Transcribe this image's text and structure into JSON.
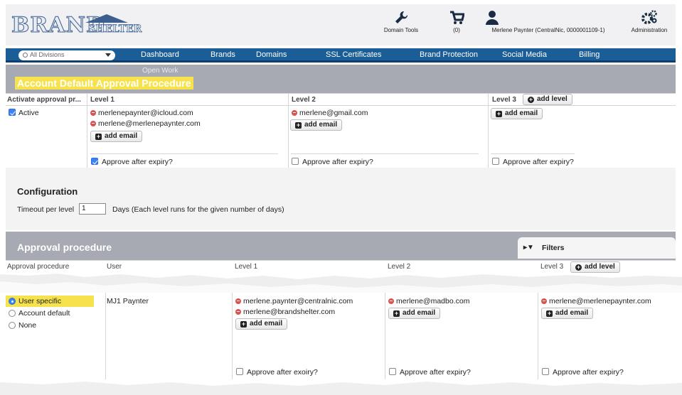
{
  "brand": {
    "logo_main": "BRAND",
    "logo_sub": "SHELTER"
  },
  "header_tools": {
    "domain_tools": "Domain Tools",
    "cart_count": "(0)",
    "user": "Merlene Paynter (CentralNic, 0000001109-1)",
    "administration": "Administration"
  },
  "nav": {
    "division_select": "All Divisions",
    "items": [
      "Dashboard",
      "Brands",
      "Domains",
      "SSL Certificates",
      "Brand Protection",
      "Social Media",
      "Billing"
    ],
    "sub_item": "Open Work"
  },
  "account_default": {
    "title": "Account Default Approval Procedure",
    "columns": [
      "Activate approval pr...",
      "Level 1",
      "Level 2",
      "Level 3"
    ],
    "add_level": "add level",
    "active_label": "Active",
    "active_checked": true,
    "level1_emails": [
      "merlenepaynter@icloud.com",
      "merlene@merlenepaynter.com"
    ],
    "level2_emails": [
      "merlene@gmail.com"
    ],
    "add_email": "add email",
    "approve_after_expiry": "Approve after expiry?",
    "approve_checked": [
      true,
      false,
      false
    ]
  },
  "configuration": {
    "title": "Configuration",
    "timeout_label": "Timeout per level",
    "timeout_value": "1",
    "days_note": "Days (Each level runs for the given number of days)"
  },
  "approval_procedure": {
    "title": "Approval procedure",
    "filters": "Filters",
    "columns": [
      "Approval procedure",
      "User",
      "Level 1",
      "Level 2",
      "Level 3"
    ],
    "add_level": "add level",
    "options": [
      "User specific",
      "Account default",
      "None"
    ],
    "selected": "User specific",
    "row": {
      "user": "MJ1 Paynter",
      "level1_emails": [
        "merlene.paynter@centralnic.com",
        "merlene@brandshelter.com"
      ],
      "level2_emails": [
        "merlene@madbo.com"
      ],
      "level3_emails": [
        "merlene@merlenepaynter.com"
      ],
      "add_email": "add email",
      "approve_after_expiry": [
        "Approve after exoiry?",
        "Approve after expiry?",
        "Approve after expiry?"
      ]
    }
  },
  "colors": {
    "nav_blue": "#1b5d96",
    "section_gray": "#a7aab3",
    "highlight": "#f5e24c",
    "remove_red": "#d9534f"
  }
}
